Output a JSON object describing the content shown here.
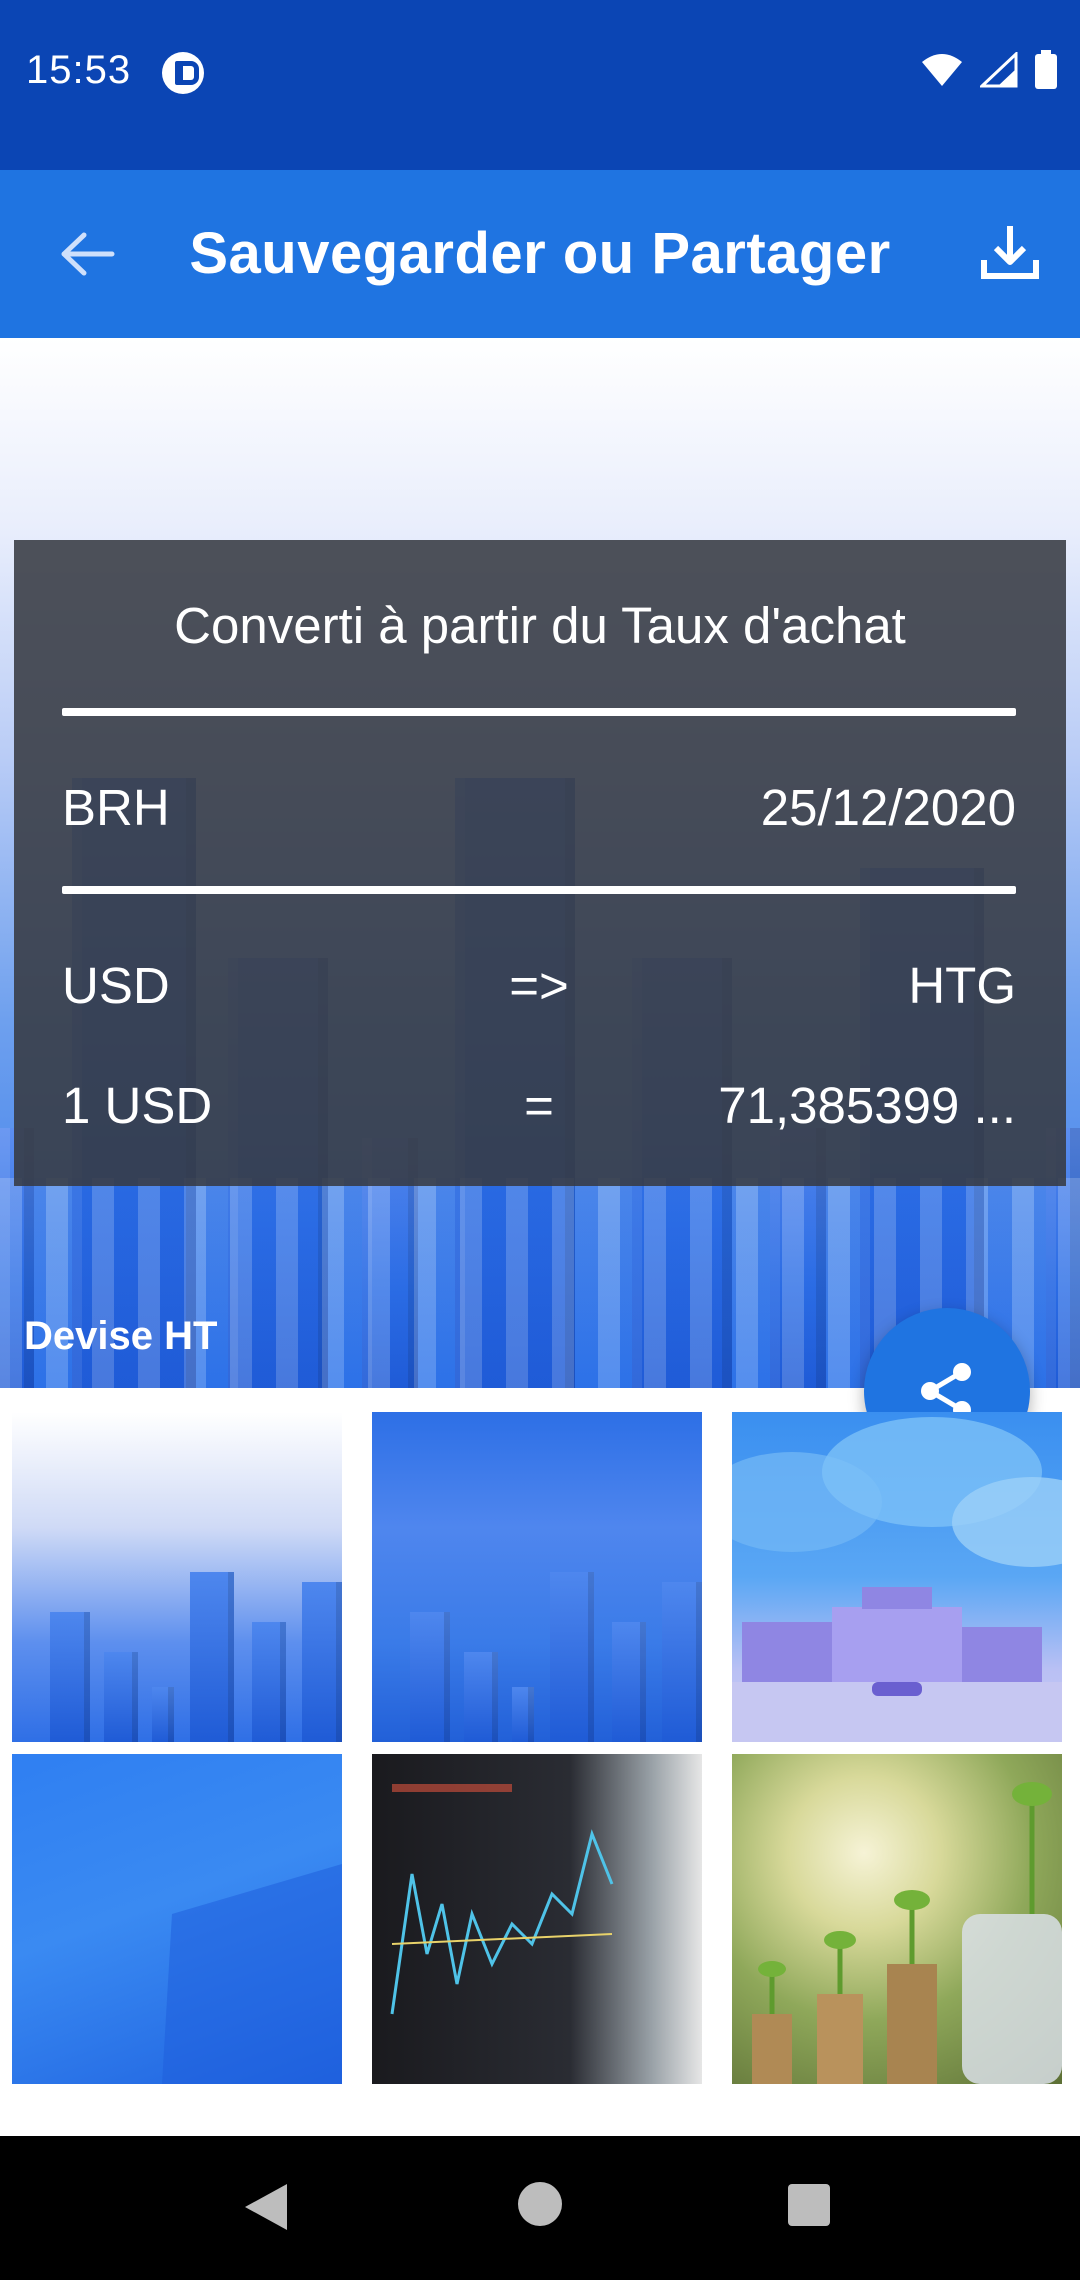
{
  "status_bar": {
    "time": "15:53",
    "icons": [
      "app-notification-icon",
      "wifi-icon",
      "signal-icon",
      "battery-icon"
    ]
  },
  "app_bar": {
    "title": "Sauvegarder ou Partager",
    "back_icon": "arrow-left-icon",
    "download_icon": "download-icon"
  },
  "card": {
    "title": "Converti à partir du Taux d'achat",
    "source": "BRH",
    "date": "25/12/2020",
    "from_currency": "USD",
    "arrow": "=>",
    "to_currency": "HTG",
    "amount_left": "1 USD",
    "equals": "=",
    "amount_right": "71,385399 ..."
  },
  "preview": {
    "watermark": "Devise HT"
  },
  "fab": {
    "icon": "share-icon"
  },
  "thumbnails": [
    "blue-bars-light",
    "blue-bars-dark",
    "city-clouds",
    "blue-gradient",
    "stock-chart-photo",
    "coins-plants-photo"
  ],
  "colors": {
    "status_bar": "#0b45b4",
    "app_bar": "#1f74e1",
    "card_bg": "#373a42",
    "fab": "#1f74e1"
  }
}
